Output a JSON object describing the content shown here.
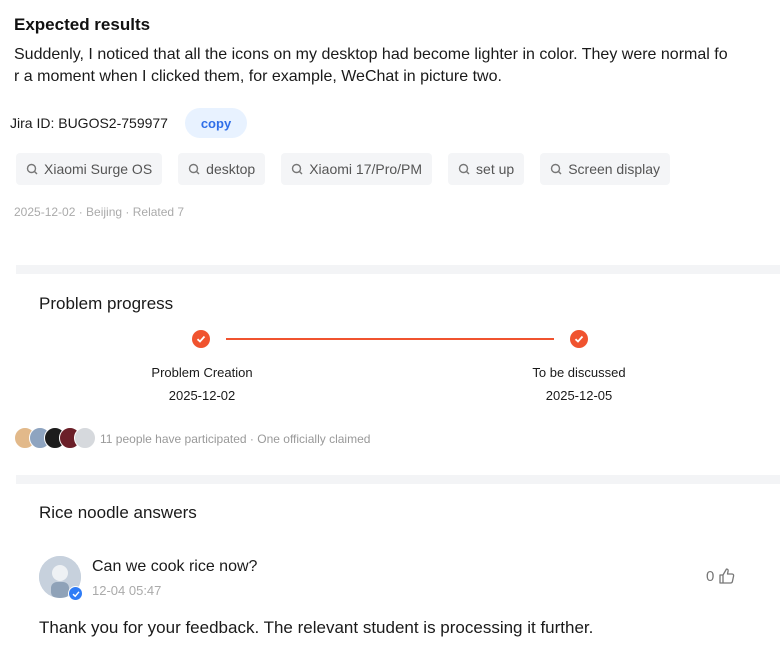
{
  "expected": {
    "title": "Expected results",
    "line1": "Suddenly, I noticed that all the icons on my desktop had become lighter in color. They were normal fo",
    "line2": "r a moment when I clicked them, for example, WeChat in picture two."
  },
  "jira": {
    "label": "Jira ID: BUGOS2-759977",
    "copy_label": "copy"
  },
  "tags": [
    "Xiaomi Surge OS",
    "desktop",
    "Xiaomi 17/Pro/PM",
    "set up",
    "Screen display"
  ],
  "meta": "2025-12-02 · Beijing · Related 7",
  "progress": {
    "title": "Problem progress",
    "steps": [
      {
        "label": "Problem Creation",
        "date": "2025-12-02"
      },
      {
        "label": "To be discussed",
        "date": "2025-12-05"
      }
    ],
    "participants": "11 people have participated",
    "claimed": "One officially claimed"
  },
  "answers": {
    "title": "Rice noodle answers",
    "username": "Can we cook rice now?",
    "timestamp": "12-04 05:47",
    "likes": "0",
    "text": "Thank you for your feedback. The relevant student is processing it further."
  },
  "colors": {
    "accent": "#f0532f",
    "link": "#2f6ee8",
    "tag_bg": "#f4f5f7"
  },
  "icons": [
    "tag-search-icon",
    "check-icon",
    "thumbs-up-icon",
    "verified-badge-icon"
  ]
}
